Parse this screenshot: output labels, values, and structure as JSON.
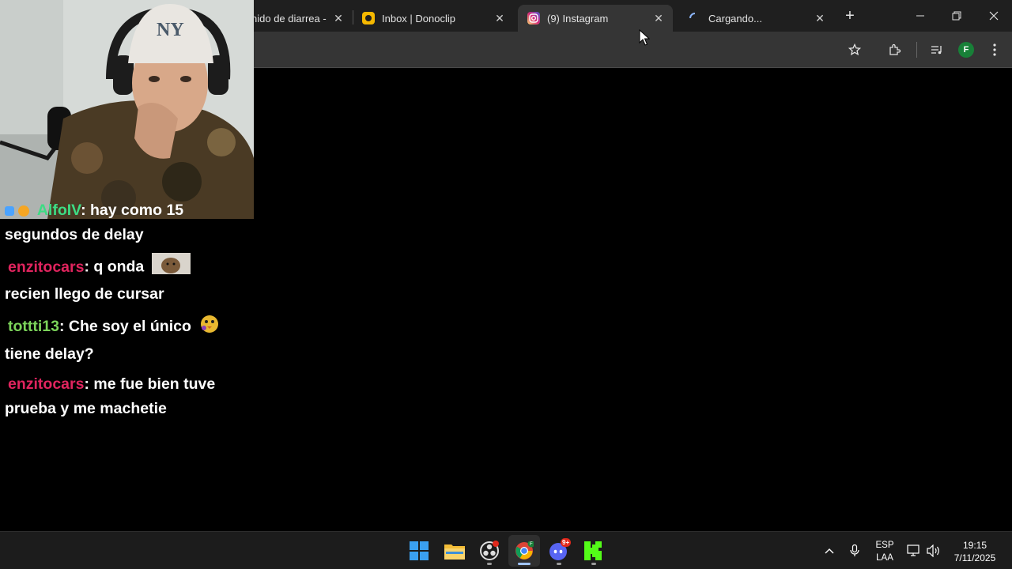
{
  "browser": {
    "tabs": [
      {
        "title": "nido de diarrea -",
        "active": false,
        "favicon": "youtube-icon"
      },
      {
        "title": "Inbox | Donoclip",
        "active": false,
        "favicon": "donoclip-icon"
      },
      {
        "title": "(9) Instagram",
        "active": true,
        "favicon": "instagram-icon"
      },
      {
        "title": "Cargando...",
        "active": false,
        "favicon": "loading-spinner-icon"
      }
    ],
    "profile_initial": "F"
  },
  "chat": {
    "messages": [
      {
        "user": "AlfoIV",
        "user_color": "#3ddc84",
        "text": ": hay como 15 segundos de delay",
        "line1": ": hay como 15",
        "line2": "segundos de delay"
      },
      {
        "user": "enzitocars",
        "user_color": "#e0245e",
        "text": ": q onda recien llego de cursar",
        "line1": ": q onda",
        "line2": "recien llego de cursar"
      },
      {
        "user": "tottti13",
        "user_color": "#7bd35a",
        "text": ": Che soy el único tiene delay?",
        "line1": ": Che soy el único",
        "line2": "tiene delay?"
      },
      {
        "user": "enzitocars",
        "user_color": "#e0245e",
        "text": ": me fue bien tuve prueba y me machetie",
        "line1": ": me fue bien tuve",
        "line2": "prueba y me machetie"
      }
    ]
  },
  "taskbar": {
    "apps": [
      "windows-start-icon",
      "file-explorer-icon",
      "obs-icon",
      "chrome-icon",
      "discord-icon",
      "kick-icon"
    ],
    "discord_badge": "9+",
    "language": "ESP",
    "layout": "LAA",
    "time": "19:15",
    "date": "7/11/2025"
  },
  "colors": {
    "titlebar": "#1f1f1f",
    "toolbar": "#353535",
    "taskbar": "#1c1c1c",
    "content": "#000000"
  }
}
